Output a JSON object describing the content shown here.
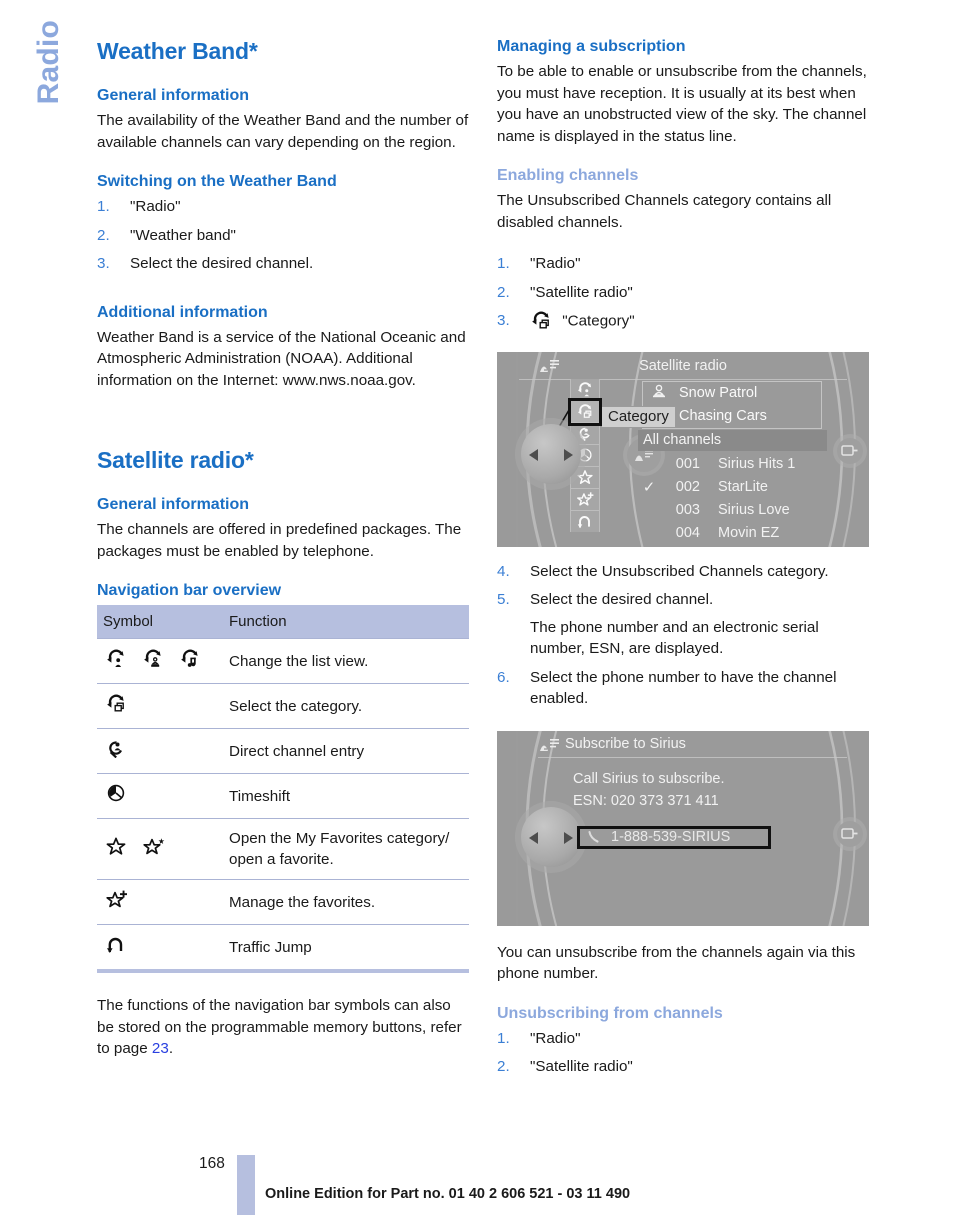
{
  "chapter_tab": "Radio",
  "left_column": {
    "title": "Weather Band*",
    "general_info_heading": "General information",
    "general_info_text": "The availability of the Weather Band and the number of available channels can vary depending on the region.",
    "switching_heading": "Switching on the Weather Band",
    "switching_steps": [
      {
        "num": "1.",
        "text": "\"Radio\""
      },
      {
        "num": "2.",
        "text": "\"Weather band\""
      },
      {
        "num": "3.",
        "text": "Select the desired channel."
      }
    ],
    "additional_heading": "Additional information",
    "additional_text": "Weather Band is a service of the National Oceanic and Atmospheric Administration (NOAA). Additional information on the Internet: www.nws.noaa.gov.",
    "satellite_title": "Satellite radio*",
    "satellite_general_heading": "General information",
    "satellite_general_text": "The channels are offered in predefined packages. The packages must be enabled by telephone.",
    "navbar_heading": "Navigation bar overview",
    "table": {
      "headers": [
        "Symbol",
        "Function"
      ],
      "rows": [
        {
          "icons": [
            "rotate-list-person-icon",
            "rotate-list-artist-icon",
            "rotate-list-music-icon"
          ],
          "function": "Change the list view."
        },
        {
          "icons": [
            "rotate-category-icon"
          ],
          "function": "Select the category."
        },
        {
          "icons": [
            "direct-entry-icon"
          ],
          "function": "Direct channel entry"
        },
        {
          "icons": [
            "timeshift-icon"
          ],
          "function": "Timeshift"
        },
        {
          "icons": [
            "star-icon",
            "star-favorite-icon"
          ],
          "function": "Open the My Favorites category/ open a favorite."
        },
        {
          "icons": [
            "star-plus-icon"
          ],
          "function": "Manage the favorites."
        },
        {
          "icons": [
            "traffic-jump-icon"
          ],
          "function": "Traffic Jump"
        }
      ]
    },
    "closing_text_before": "The functions of the navigation bar symbols can also be stored on the programmable memory buttons, refer to page ",
    "closing_page_link": "23",
    "closing_text_after": "."
  },
  "right_column": {
    "managing_heading": "Managing a subscription",
    "managing_text": "To be able to enable or unsubscribe from the channels, you must have reception. It is usually at its best when you have an unobstructed view of the sky. The channel name is displayed in the status line.",
    "enabling_heading": "Enabling channels",
    "enabling_text": "The Unsubscribed Channels category contains all disabled channels.",
    "enabling_steps": [
      {
        "num": "1.",
        "text": "\"Radio\"",
        "icon": ""
      },
      {
        "num": "2.",
        "text": "\"Satellite radio\"",
        "icon": ""
      },
      {
        "num": "3.",
        "text": "\"Category\"",
        "icon": "rotate-category-icon"
      }
    ],
    "enabling_steps_cont": [
      {
        "num": "4.",
        "text": "Select the Unsubscribed Channels category.",
        "note": ""
      },
      {
        "num": "5.",
        "text": "Select the desired channel.",
        "note": "The phone number and an electronic serial number, ESN, are displayed."
      },
      {
        "num": "6.",
        "text": "Select the phone number to have the channel enabled.",
        "note": ""
      }
    ],
    "unsubscribe_note": "You can unsubscribe from the channels again via this phone number.",
    "unsubscribing_heading": "Unsubscribing from channels",
    "unsubscribing_steps": [
      {
        "num": "1.",
        "text": "\"Radio\""
      },
      {
        "num": "2.",
        "text": "\"Satellite radio\""
      }
    ]
  },
  "screenshot_satellite": {
    "title": "Satellite radio",
    "category_label": "Category",
    "now_playing": [
      {
        "icon": "artist-icon",
        "text": "Snow Patrol"
      },
      {
        "icon": "",
        "text": "Chasing Cars"
      }
    ],
    "all_channels_label": "All channels",
    "channels": [
      {
        "check": "",
        "number": "001",
        "name": "Sirius Hits 1"
      },
      {
        "check": "✓",
        "number": "002",
        "name": "StarLite"
      },
      {
        "check": "",
        "number": "003",
        "name": "Sirius Love"
      },
      {
        "check": "",
        "number": "004",
        "name": "Movin EZ"
      }
    ],
    "nav_icons": [
      "rotate-list-person-icon",
      "rotate-category-icon",
      "direct-entry-icon",
      "timeshift-icon",
      "star-icon",
      "star-plus-icon",
      "traffic-jump-icon"
    ],
    "selected_nav_index": 1
  },
  "screenshot_subscribe": {
    "title": "Subscribe to Sirius",
    "line1": "Call Sirius to subscribe.",
    "line2": "ESN: 020 373 371 411",
    "phone_number": "1-888-539-SIRIUS",
    "phone_icon": "handset-icon"
  },
  "footer": {
    "page_number": "168",
    "text": "Online Edition for Part no. 01 40 2 606 521 - 03 11 490"
  },
  "colors": {
    "heading_blue": "#1a6fc4",
    "light_blue": "#8ca8dd",
    "table_header": "#b6bfdf",
    "link_blue": "#2a40e0"
  }
}
